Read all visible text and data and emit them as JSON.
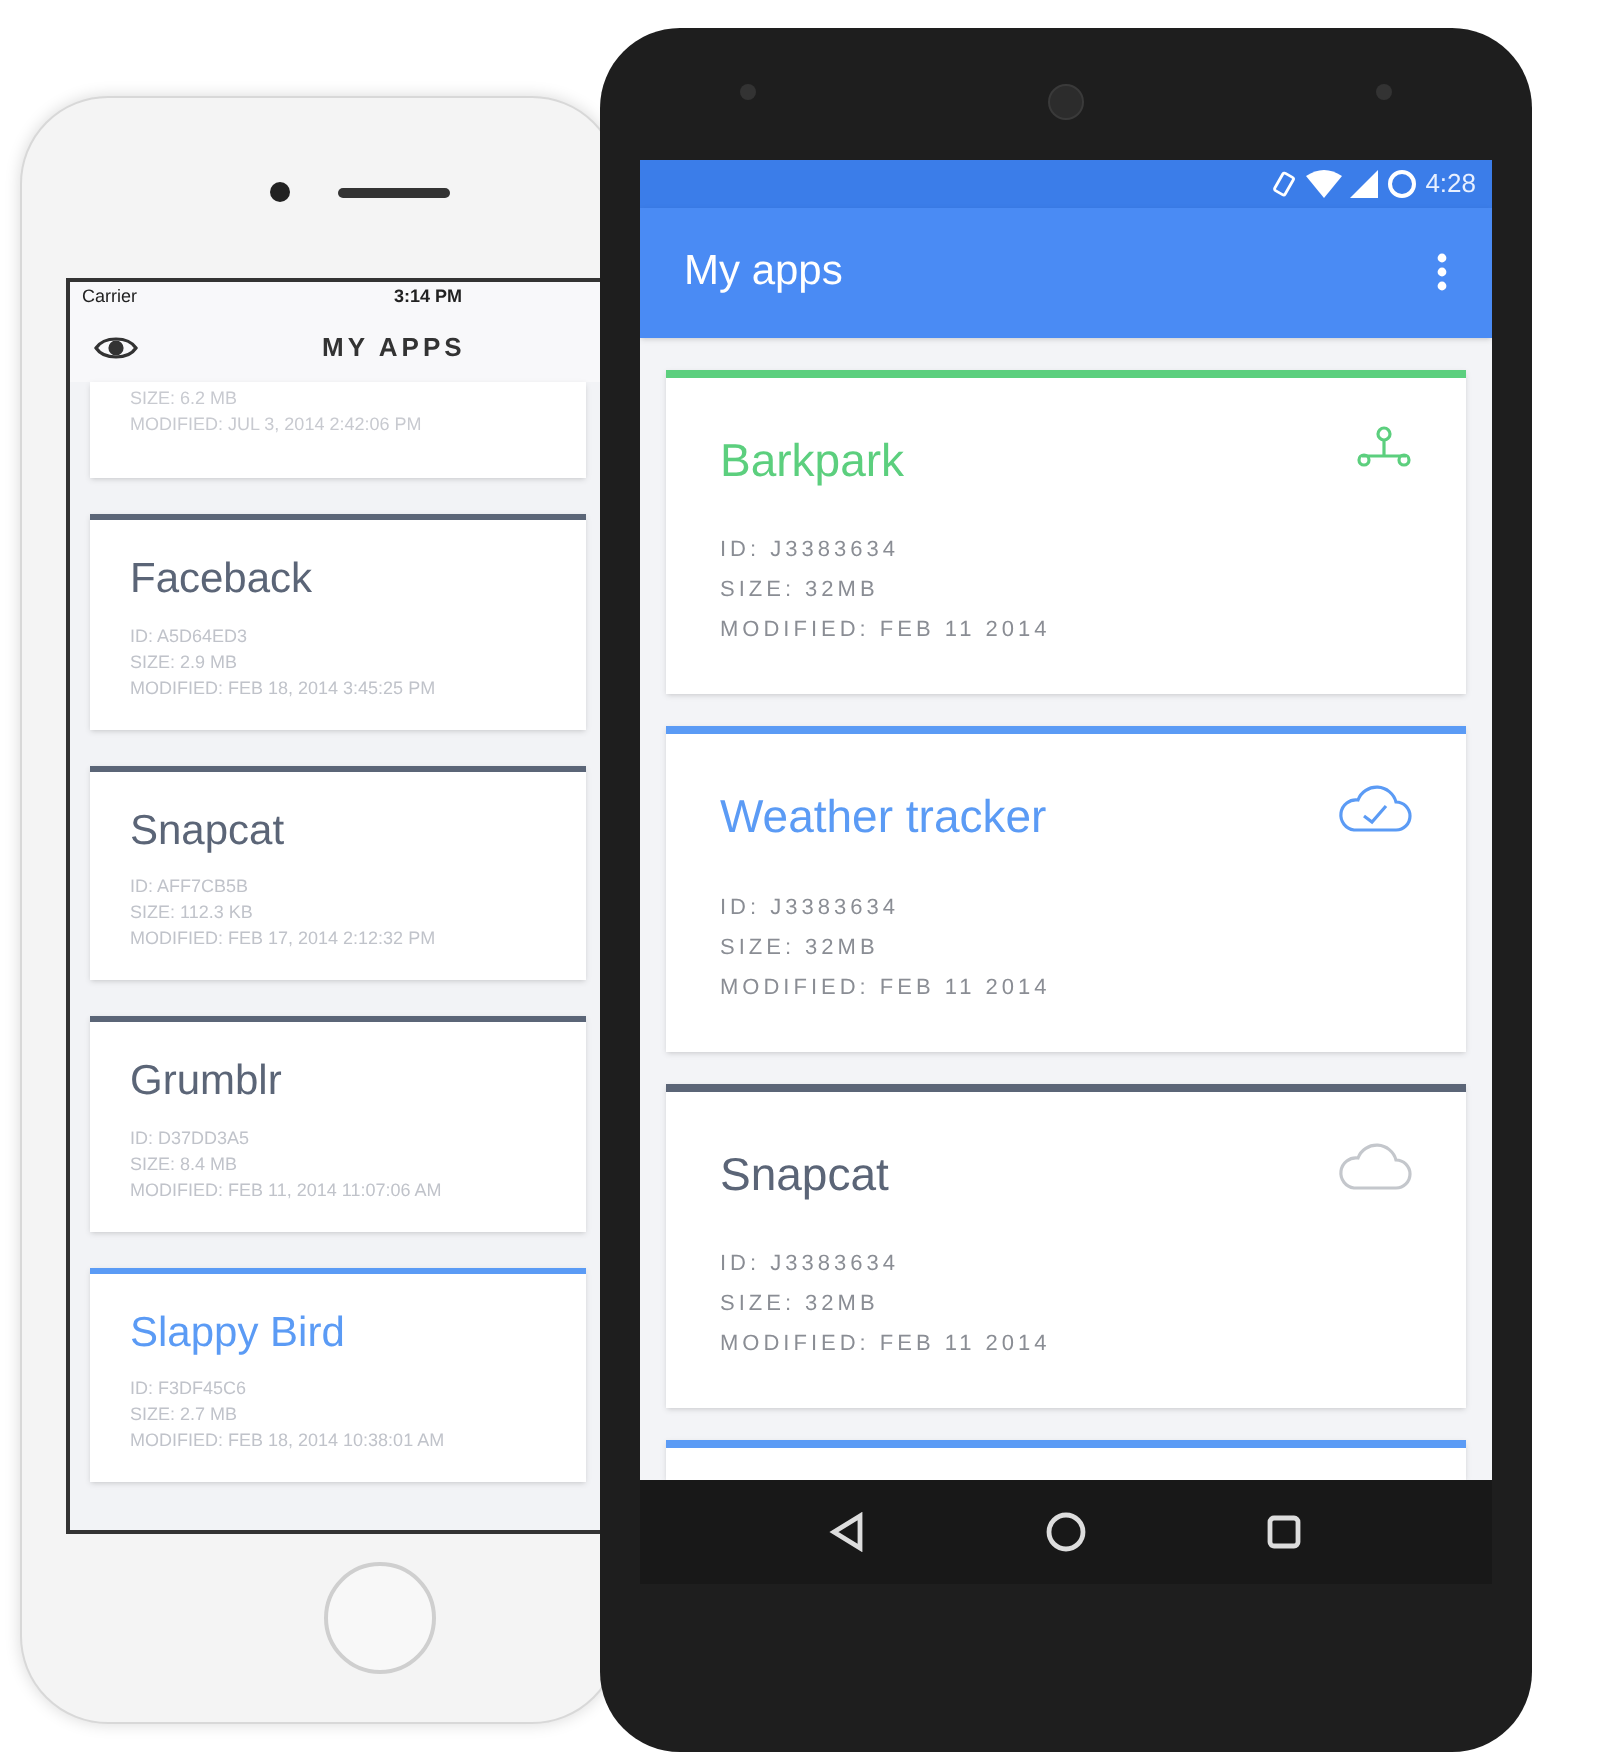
{
  "ios": {
    "status": {
      "carrier": "Carrier",
      "time": "3:14 PM"
    },
    "title": "MY APPS",
    "partial_card": {
      "lines": [
        "SIZE: 6.2 MB",
        "MODIFIED: JUL 3, 2014 2:42:06 PM"
      ]
    },
    "cards": [
      {
        "name": "Faceback",
        "color": "#5b6577",
        "lines": [
          "ID: A5D64ED3",
          "SIZE: 2.9 MB",
          "MODIFIED: FEB 18, 2014 3:45:25 PM"
        ]
      },
      {
        "name": "Snapcat",
        "color": "#5b6577",
        "lines": [
          "ID: AFF7CB5B",
          "SIZE: 112.3 KB",
          "MODIFIED: FEB 17, 2014 2:12:32 PM"
        ]
      },
      {
        "name": "Grumblr",
        "color": "#5b6577",
        "lines": [
          "ID: D37DD3A5",
          "SIZE: 8.4 MB",
          "MODIFIED: FEB 11, 2014 11:07:06 AM"
        ]
      },
      {
        "name": "Slappy Bird",
        "color": "#5b9bf5",
        "lines": [
          "ID: F3DF45C6",
          "SIZE: 2.7 MB",
          "MODIFIED: FEB 18, 2014 10:38:01 AM"
        ]
      }
    ]
  },
  "android": {
    "status_time": "4:28",
    "title": "My apps",
    "cards": [
      {
        "name": "Barkpark",
        "color": "#5ccf7e",
        "kind": "share",
        "lines": [
          "ID: J3383634",
          "SIZE: 32MB",
          "MODIFIED: FEB 11 2014"
        ]
      },
      {
        "name": "Weather tracker",
        "color": "#5b9bf5",
        "kind": "cloud-check",
        "lines": [
          "ID: J3383634",
          "SIZE: 32MB",
          "MODIFIED: FEB 11 2014"
        ]
      },
      {
        "name": "Snapcat",
        "color": "#5b6577",
        "kind": "cloud",
        "lines": [
          "ID: J3383634",
          "SIZE: 32MB",
          "MODIFIED: FEB 11 2014"
        ]
      }
    ],
    "partial_card": {
      "color": "#5b9bf5"
    }
  }
}
